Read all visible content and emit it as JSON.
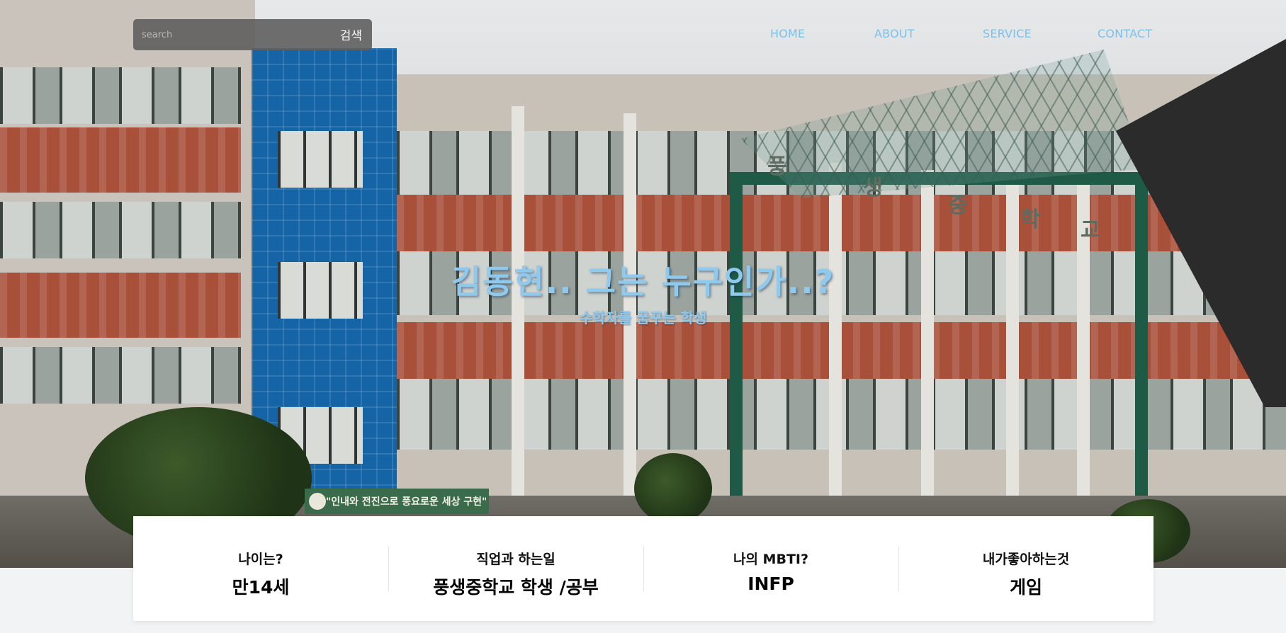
{
  "search": {
    "placeholder": "search",
    "button_label": "검색"
  },
  "nav": {
    "items": [
      {
        "label": "HOME"
      },
      {
        "label": "ABOUT"
      },
      {
        "label": "SERVICE"
      },
      {
        "label": "CONTACT"
      }
    ],
    "color": "#7bc1ea"
  },
  "hero": {
    "title": "김동현.. 그는 누구인가..?",
    "subtitle": "수학자를 꿈꾸는 학생",
    "text_color": "#8ec9ee",
    "photo": {
      "sign_text": "\"인내와 전진으로 풍요로운 세상 구현\"",
      "building_name": [
        "풍",
        "생",
        "중",
        "학",
        "교"
      ]
    }
  },
  "info": [
    {
      "label": "나이는?",
      "value": "만14세"
    },
    {
      "label": "직업과 하는일",
      "value": "풍생중학교 학생 /공부"
    },
    {
      "label": "나의 MBTI?",
      "value": "INFP"
    },
    {
      "label": "내가좋아하는것",
      "value": "게임"
    }
  ]
}
